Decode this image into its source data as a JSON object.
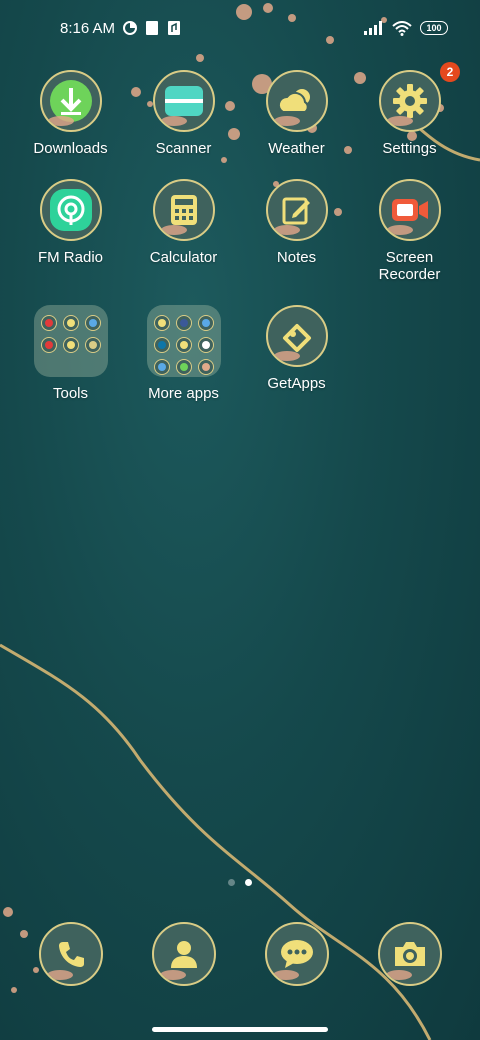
{
  "status_bar": {
    "time": "8:16 AM",
    "battery": "100",
    "icons": [
      "data-saver-icon",
      "notification-icon",
      "file-icon",
      "signal-icon",
      "wifi-icon",
      "battery-icon"
    ]
  },
  "apps": [
    {
      "label": "Downloads",
      "icon": "download-icon"
    },
    {
      "label": "Scanner",
      "icon": "scanner-icon"
    },
    {
      "label": "Weather",
      "icon": "weather-icon"
    },
    {
      "label": "Settings",
      "icon": "gear-icon",
      "badge": "2"
    },
    {
      "label": "FM Radio",
      "icon": "radio-icon"
    },
    {
      "label": "Calculator",
      "icon": "calculator-icon"
    },
    {
      "label": "Notes",
      "icon": "notes-icon"
    },
    {
      "label": "Screen Recorder",
      "icon": "screen-recorder-icon"
    },
    {
      "label": "Tools",
      "icon": "folder-icon"
    },
    {
      "label": "More apps",
      "icon": "folder-icon"
    },
    {
      "label": "GetApps",
      "icon": "getapps-icon"
    }
  ],
  "dock": [
    {
      "name": "phone",
      "icon": "phone-icon"
    },
    {
      "name": "contacts",
      "icon": "contacts-icon"
    },
    {
      "name": "messages",
      "icon": "messages-icon"
    },
    {
      "name": "camera",
      "icon": "camera-icon"
    }
  ],
  "pager": {
    "pages": 2,
    "current": 2
  },
  "colors": {
    "icon_bg": "#3f625d",
    "icon_ring": "#d9cc86",
    "badge": "#e5491e",
    "wallpaper": "#15494c"
  }
}
